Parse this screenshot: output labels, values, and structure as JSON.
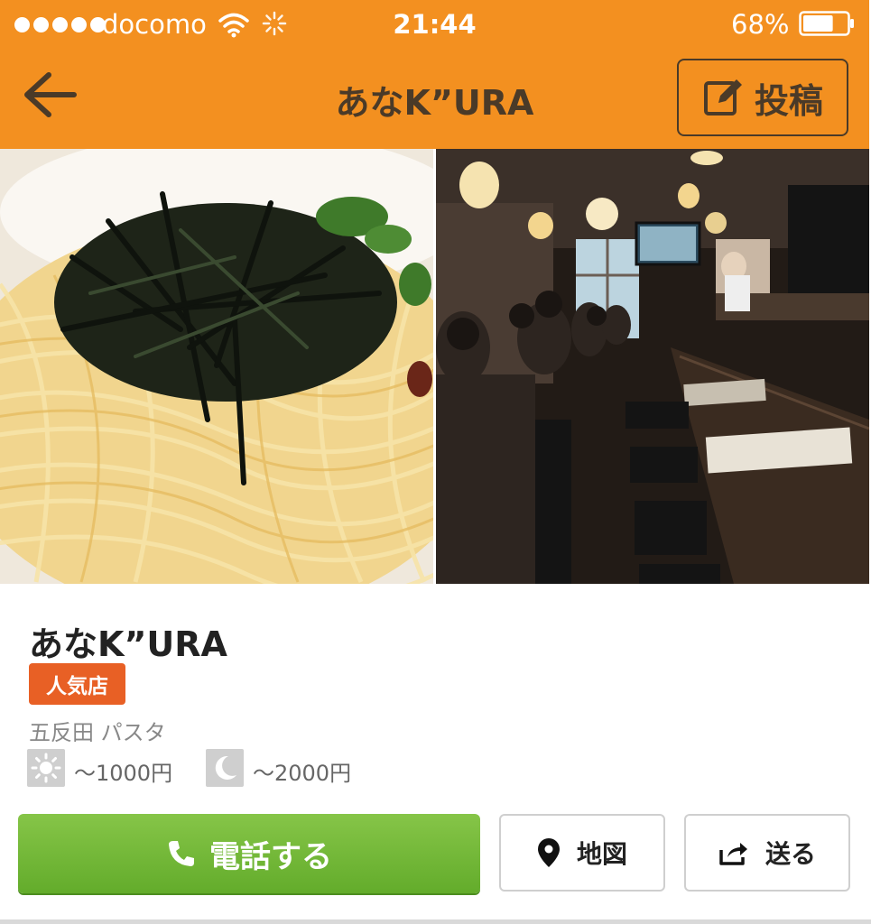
{
  "status_bar": {
    "carrier": "docomo",
    "time": "21:44",
    "battery_percent": "68%",
    "battery_level": 0.68
  },
  "nav": {
    "title": "あなK”URA",
    "post_label": "投稿"
  },
  "shop": {
    "name": "あなK”URA",
    "badge": "人気店",
    "area": "五反田 パスタ",
    "lunch_price": "〜1000円",
    "dinner_price": "〜2000円"
  },
  "actions": {
    "call_label": "電話する",
    "map_label": "地図",
    "send_label": "送る"
  },
  "colors": {
    "header": "#f39020",
    "badge": "#e86025",
    "call_button": "#6ab532"
  }
}
